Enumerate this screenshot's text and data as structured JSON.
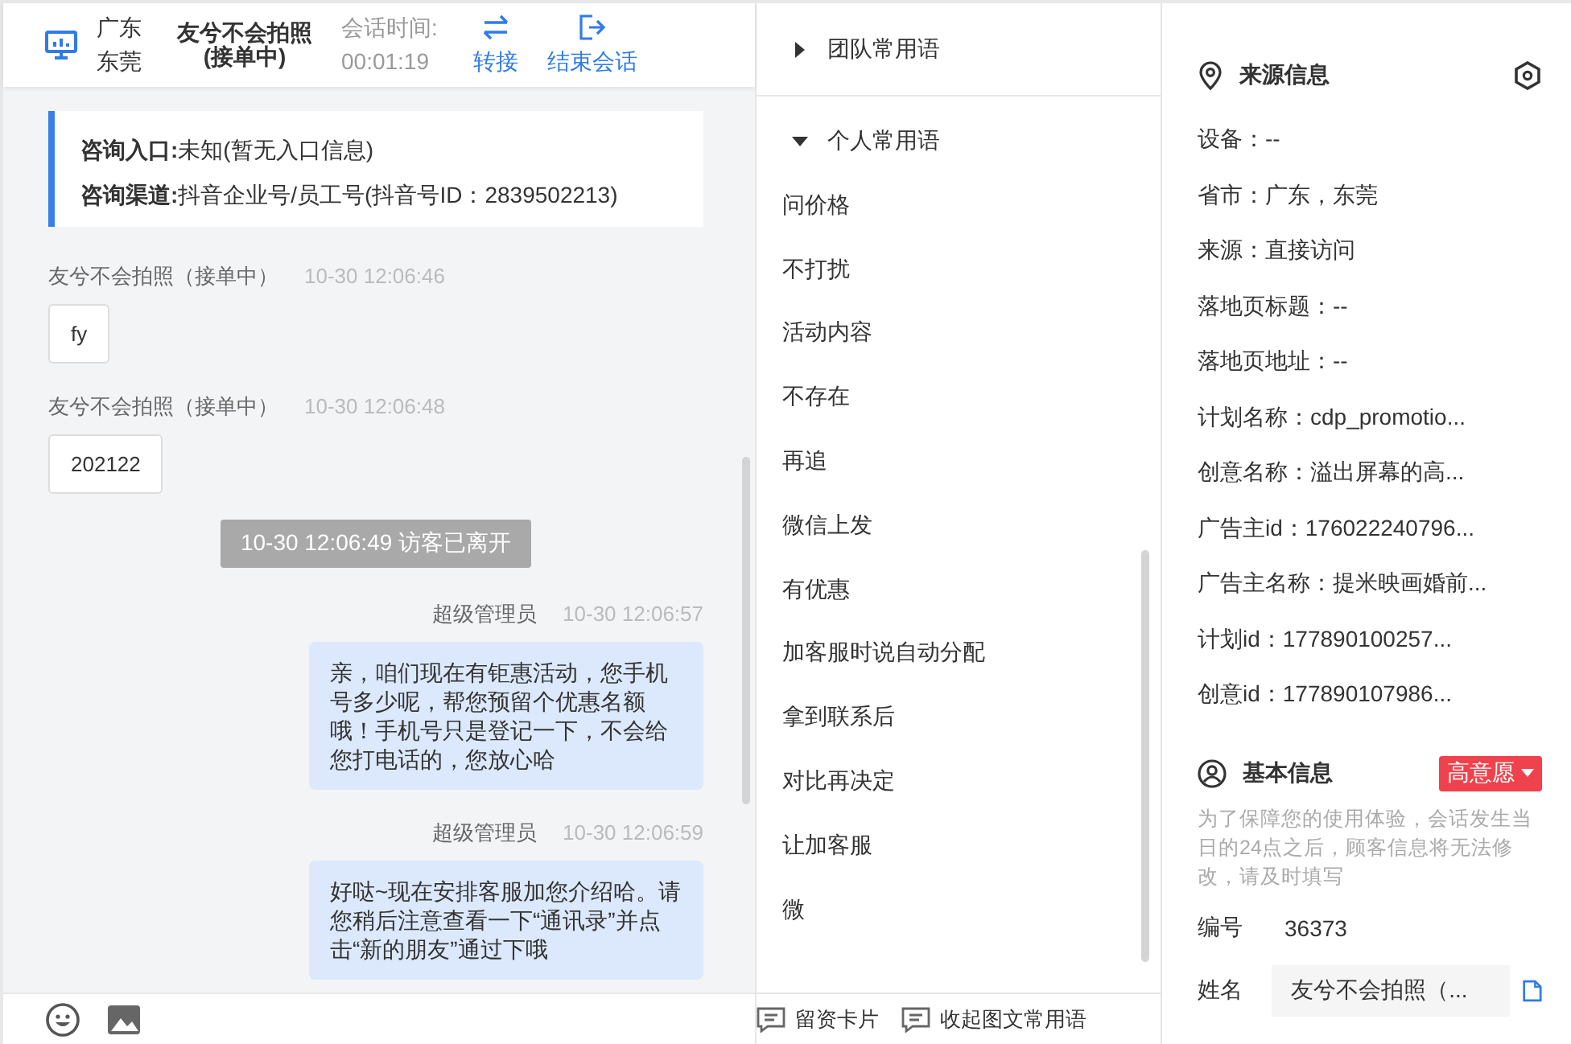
{
  "header": {
    "province": "广东",
    "city": "东莞",
    "visitor_name": "友兮不会拍照",
    "visitor_status": "(接单中)",
    "session_label": "会话时间:",
    "session_time": "00:01:19",
    "actions": [
      {
        "kind": "transfer",
        "label": "转接"
      },
      {
        "kind": "end",
        "label": "结束会话"
      }
    ]
  },
  "entry_card": [
    {
      "label": "咨询入口:",
      "value": "未知(暂无入口信息)"
    },
    {
      "label": "咨询渠道:",
      "value": "抖音企业号/员工号(抖音号ID：2839502213)"
    }
  ],
  "messages": [
    {
      "kind": "visitor",
      "sender": "友兮不会拍照（接单中）",
      "time": "10-30 12:06:46",
      "text": "fy"
    },
    {
      "kind": "visitor",
      "sender": "友兮不会拍照（接单中）",
      "time": "10-30 12:06:48",
      "text": "202122"
    },
    {
      "kind": "system",
      "text": "10-30 12:06:49 访客已离开"
    },
    {
      "kind": "agent",
      "sender": "超级管理员",
      "time": "10-30 12:06:57",
      "text": "亲，咱们现在有钜惠活动，您手机号多少呢，帮您预留个优惠名额哦！手机号只是登记一下，不会给您打电话的，您放心哈"
    },
    {
      "kind": "agent",
      "sender": "超级管理员",
      "time": "10-30 12:06:59",
      "text": "好哒~现在安排客服加您介绍哈。请您稍后注意查看一下“通讯录”并点击“新的朋友”通过下哦"
    }
  ],
  "phrase_groups": [
    {
      "label": "团队常用语",
      "expanded": false
    },
    {
      "label": "个人常用语",
      "expanded": true,
      "items": [
        "问价格",
        "不打扰",
        "活动内容",
        "不存在",
        "再追",
        "微信上发",
        "有优惠",
        "加客服时说自动分配",
        "拿到联系后",
        "对比再决定",
        "让加客服",
        "微"
      ]
    }
  ],
  "phrase_footer": [
    "留资卡片",
    "收起图文常用语"
  ],
  "source_info": {
    "title": "来源信息",
    "fields": [
      "设备：--",
      "省市：广东，东莞",
      "来源：直接访问",
      "落地页标题：--",
      "落地页地址：--",
      "计划名称：cdp_promotio...",
      "创意名称：溢出屏幕的高...",
      "广告主id：176022240796...",
      "广告主名称：提米映画婚前...",
      "计划id：177890100257...",
      "创意id：177890107986..."
    ]
  },
  "basic_info": {
    "title": "基本信息",
    "intent": "高意愿",
    "notice": "为了保障您的使用体验，会话发生当日的24点之后，顾客信息将无法修改，请及时填写",
    "number_label": "编号",
    "number": "36373",
    "name_label": "姓名",
    "name_value": "友兮不会拍照（..."
  }
}
